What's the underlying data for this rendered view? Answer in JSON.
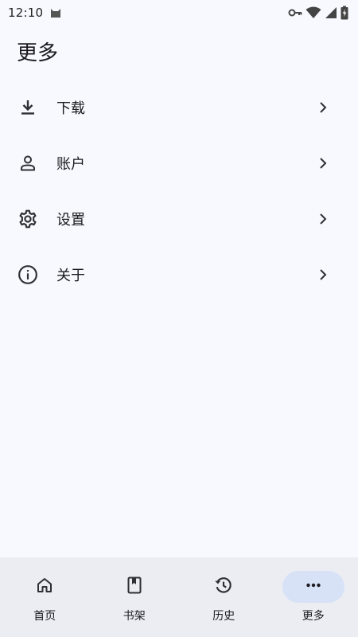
{
  "status_bar": {
    "time": "12:10"
  },
  "page": {
    "title": "更多"
  },
  "menu": {
    "items": [
      {
        "label": "下载",
        "icon": "download-icon"
      },
      {
        "label": "账户",
        "icon": "person-icon"
      },
      {
        "label": "设置",
        "icon": "gear-icon"
      },
      {
        "label": "关于",
        "icon": "info-icon"
      }
    ]
  },
  "bottom_nav": {
    "items": [
      {
        "label": "首页",
        "icon": "home-icon",
        "active": false
      },
      {
        "label": "书架",
        "icon": "bookmark-book-icon",
        "active": false
      },
      {
        "label": "历史",
        "icon": "history-icon",
        "active": false
      },
      {
        "label": "更多",
        "icon": "more-horiz-icon",
        "active": true
      }
    ]
  },
  "colors": {
    "background": "#f8f9fe",
    "nav_background": "#ebedf3",
    "active_pill": "#d8e2f7",
    "text": "#1b1b1f"
  }
}
